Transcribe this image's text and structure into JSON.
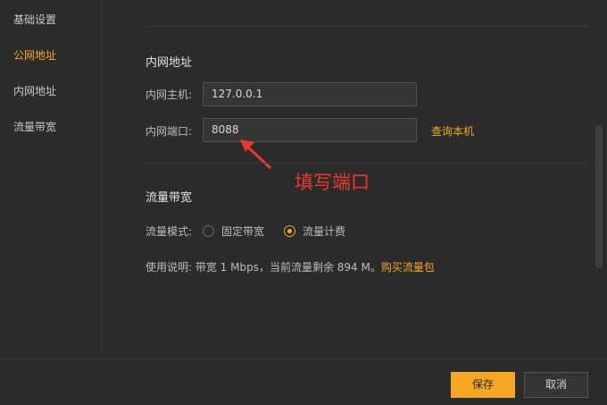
{
  "sidebar": {
    "items": [
      {
        "label": "基础设置",
        "active": false
      },
      {
        "label": "公网地址",
        "active": true
      },
      {
        "label": "内网地址",
        "active": false
      },
      {
        "label": "流量带宽",
        "active": false
      }
    ]
  },
  "intranet": {
    "title": "内网地址",
    "host_label": "内网主机:",
    "host_value": "127.0.0.1",
    "port_label": "内网端口:",
    "port_value": "8088",
    "query_link": "查询本机"
  },
  "annotation": {
    "text": "填写端口",
    "color": "#e8392b"
  },
  "bandwidth": {
    "title": "流量带宽",
    "mode_label": "流量模式:",
    "options": [
      {
        "label": "固定带宽",
        "selected": false
      },
      {
        "label": "流量计费",
        "selected": true
      }
    ],
    "usage_text": "使用说明:  带宽 1 Mbps，当前流量剩余 894 M。",
    "buy_link": "购买流量包"
  },
  "footer": {
    "save_label": "保存",
    "cancel_label": "取消"
  },
  "colors": {
    "accent": "#f5a623",
    "background": "#2b2b2b"
  }
}
